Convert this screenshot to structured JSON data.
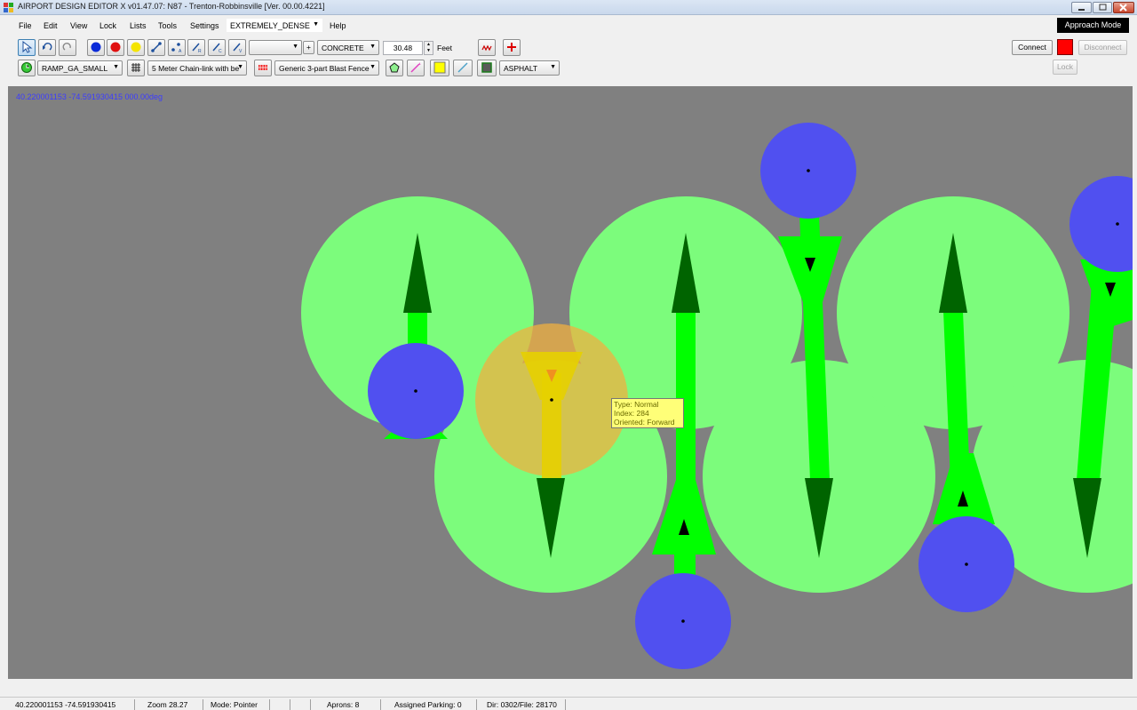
{
  "window": {
    "title": "AIRPORT DESIGN EDITOR X  v01.47.07: N87 - Trenton-Robbinsville [Ver. 00.00.4221]"
  },
  "menu": {
    "items": [
      "File",
      "Edit",
      "View",
      "Lock",
      "Lists",
      "Tools",
      "Settings"
    ],
    "density": "EXTREMELY_DENSE",
    "help": "Help"
  },
  "approach_mode_label": "Approach Mode",
  "toolbar": {
    "line_select": "",
    "surface_select": "CONCRETE",
    "width_value": "30.48",
    "width_unit": "Feet",
    "ramp_select": "RAMP_GA_SMALL",
    "fence_select": "5 Meter Chain-link with be",
    "blast_fence_select": "Generic 3-part Blast Fence",
    "pavement_select": "ASPHALT"
  },
  "network": {
    "connect": "Connect",
    "disconnect": "Disconnect",
    "lock": "Lock",
    "status_color": "#ff0000"
  },
  "canvas": {
    "coord_readout": "40.220001153   -74.591930415 000.00deg"
  },
  "tooltip": {
    "line1": "Type: Normal",
    "line2": "Index: 284",
    "line3": "Oriented: Forward"
  },
  "statusbar": {
    "coords": "40.220001153   -74.591930415",
    "zoom": "Zoom 28.27",
    "mode": "Mode: Pointer",
    "aprons": "Aprons: 8",
    "assigned_parking": "Assigned Parking: 0",
    "dir_file": "Dir: 0302/File: 28170"
  },
  "colors": {
    "canvas_bg": "#808080",
    "parking_circle": "#7cfc7c",
    "taxi_line": "#00ff00",
    "arrow_dark": "#006400",
    "node": "#5050f0",
    "selected": "#f0c850"
  }
}
